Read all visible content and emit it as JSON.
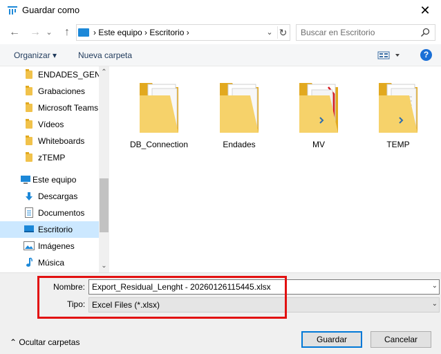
{
  "window": {
    "title": "Guardar como",
    "close_glyph": "✕"
  },
  "nav": {
    "back_glyph": "←",
    "forward_glyph": "→",
    "dropdown_glyph": "⌄",
    "up_glyph": "↑",
    "breadcrumb": [
      "Este equipo",
      "Escritorio"
    ],
    "breadcrumb_separator": ">",
    "address_text": "  ›  Este equipo  ›  Escritorio  ›",
    "search_placeholder": "Buscar en Escritorio"
  },
  "toolbar": {
    "organize_label": "Organizar ▾",
    "new_folder_label": "Nueva carpeta",
    "help_label": "?"
  },
  "sidebar": {
    "items": [
      {
        "label": "ENDADES_GENE",
        "icon": "folder-icon"
      },
      {
        "label": "Grabaciones",
        "icon": "folder-icon"
      },
      {
        "label": "Microsoft Teams",
        "icon": "folder-icon"
      },
      {
        "label": "Vídeos",
        "icon": "folder-icon"
      },
      {
        "label": "Whiteboards",
        "icon": "folder-icon"
      },
      {
        "label": "zTEMP",
        "icon": "folder-icon"
      },
      {
        "label": "Este equipo",
        "icon": "computer-icon"
      },
      {
        "label": "Descargas",
        "icon": "download-icon"
      },
      {
        "label": "Documentos",
        "icon": "documents-icon"
      },
      {
        "label": "Escritorio",
        "icon": "desktop-icon",
        "selected": true
      },
      {
        "label": "Imágenes",
        "icon": "pictures-icon"
      },
      {
        "label": "Música",
        "icon": "music-icon"
      }
    ]
  },
  "files": [
    {
      "name": "DB_Connection",
      "icon": "folder-icon"
    },
    {
      "name": "Endades",
      "icon": "folder-icon"
    },
    {
      "name": "MV",
      "icon": "folder-icon"
    },
    {
      "name": "TEMP",
      "icon": "folder-icon"
    }
  ],
  "form": {
    "name_label": "Nombre:",
    "name_value": "Export_Residual_Lenght - 20260126115445.xlsx",
    "type_label": "Tipo:",
    "type_value": "Excel Files (*.xlsx)",
    "dropdown_glyph": "⌄"
  },
  "footer": {
    "hide_folders_label": "Ocultar carpetas",
    "save_label": "Guardar",
    "cancel_label": "Cancelar"
  },
  "colors": {
    "accent": "#0078d7",
    "highlight_box": "#e21010",
    "selected_bg": "#cce8ff",
    "folder": "#f1c24b"
  }
}
